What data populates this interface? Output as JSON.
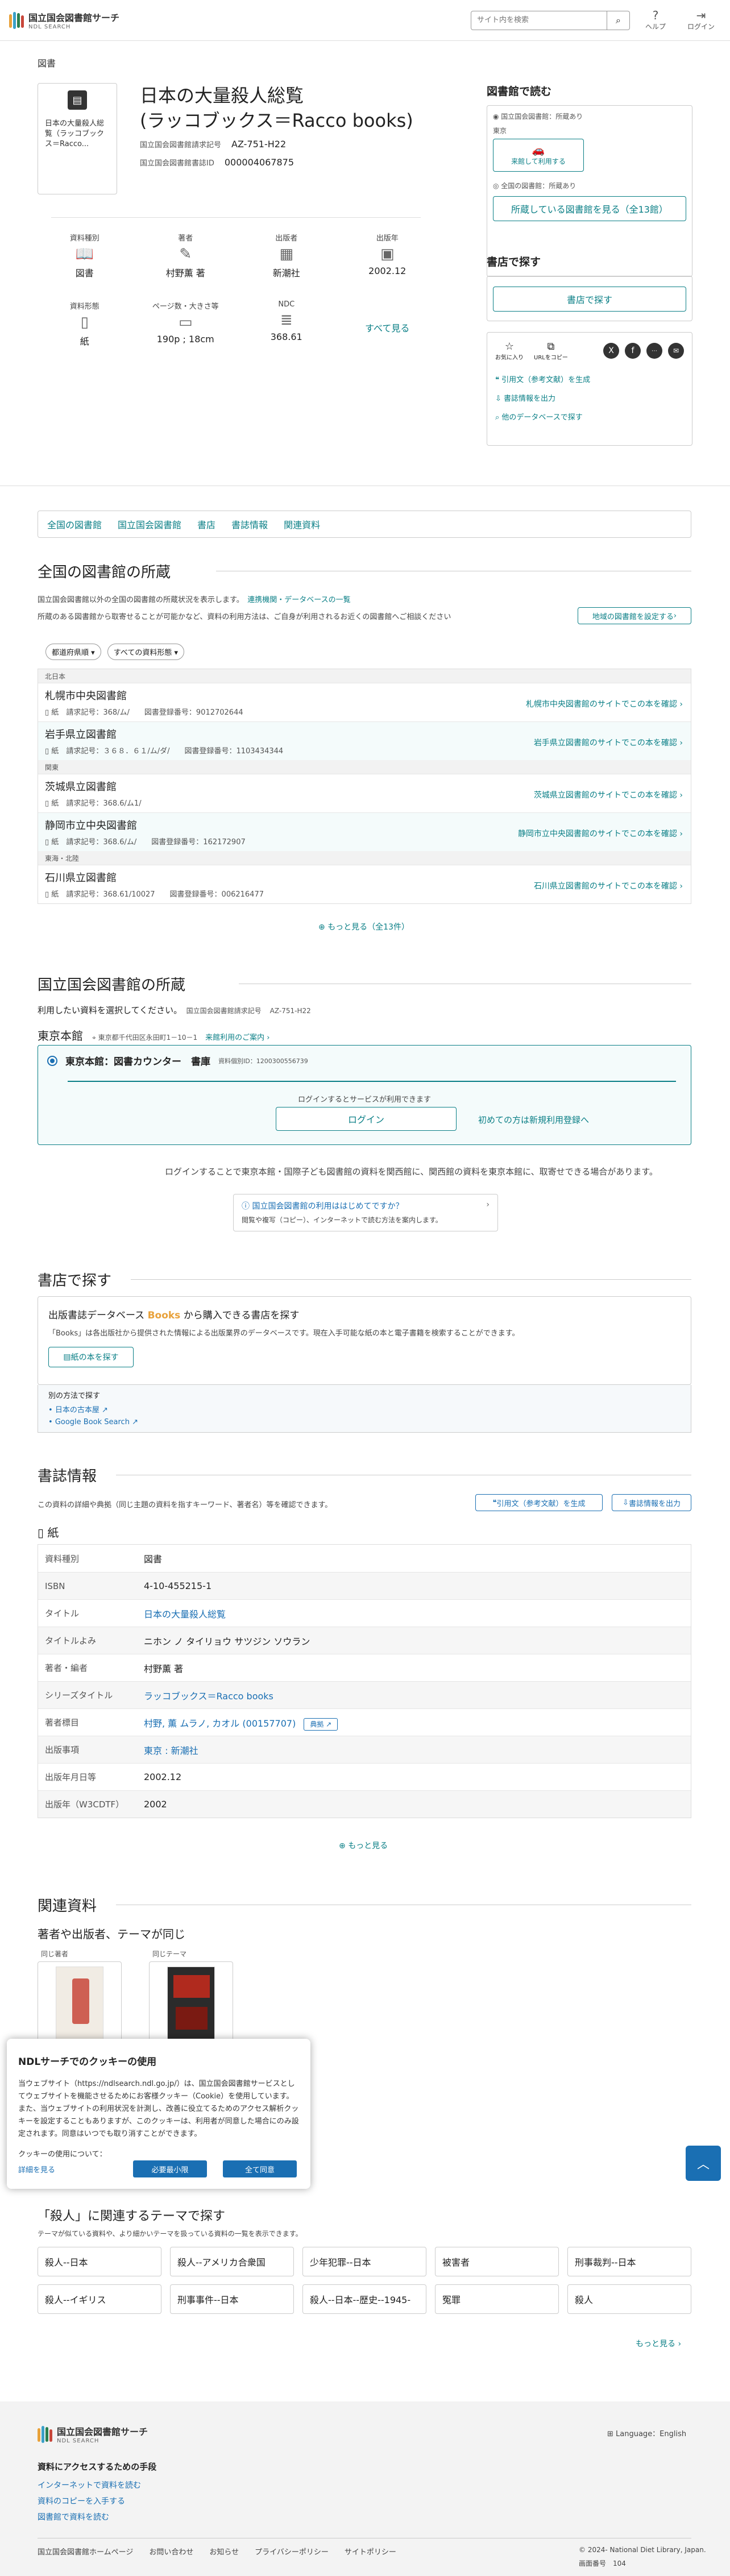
{
  "header": {
    "logo_line1": "国立国会図書館サーチ",
    "logo_line2": "NDL SEARCH",
    "search_placeholder": "サイト内を検索",
    "help": "ヘルプ",
    "login": "ログイン"
  },
  "breadcrumb": "図書",
  "record": {
    "thumb_title": "日本の大量殺人総覧（ラッコブックス＝Racco...",
    "title_line1": "日本の大量殺人総覧",
    "title_line2": "(ラッコブックス＝Racco books)",
    "callno_label": "国立国会図書館請求記号",
    "callno": "AZ-751-H22",
    "bibid_label": "国立国会図書館書誌ID",
    "bibid": "000004067875"
  },
  "attributes": [
    {
      "key": "資料種別",
      "value": "図書",
      "icon": "book-icon"
    },
    {
      "key": "著者",
      "value": "村野薫 著",
      "icon": "pen-icon"
    },
    {
      "key": "出版者",
      "value": "新潮社",
      "icon": "building-icon"
    },
    {
      "key": "出版年",
      "value": "2002.12",
      "icon": "calendar-icon"
    },
    {
      "key": "資料形態",
      "value": "紙",
      "icon": "paper-icon"
    },
    {
      "key": "ページ数・大きさ等",
      "value": "190p ; 18cm",
      "icon": "ruler-icon"
    },
    {
      "key": "NDC",
      "value": "368.61",
      "icon": "layers-icon"
    }
  ],
  "see_all": "すべて見る",
  "side": {
    "read_title": "図書館で読む",
    "ndl_owned": "国立国会図書館：所蔵あり",
    "tokyo": "東京",
    "use_at_library": "来館して利用する",
    "national_owned": "全国の図書館：所蔵あり",
    "show_libraries": "所蔵している図書館を見る（全13館）",
    "shop_title": "書店で探す",
    "find_in_shop": "書店で探す",
    "favorite": "お気に入り",
    "url_copy": "URLをコピー",
    "cite": "引用文（参考文献）を生成",
    "output": "書誌情報を出力",
    "other_db": "他のデータベースで探す"
  },
  "tabs": [
    "全国の図書館",
    "国立国会図書館",
    "書店",
    "書誌情報",
    "関連資料"
  ],
  "national": {
    "title": "全国の図書館の所蔵",
    "desc": "国立国会図書館以外の全国の図書館の所蔵状況を表示します。",
    "link": "連携機関・データベースの一覧",
    "note": "所蔵のある図書館から取寄せることが可能かなど、資料の利用方法は、ご自身が利用されるお近くの図書館へご相談ください",
    "set_region": "地域の図書館を設定する",
    "filter1": "都道府県順",
    "filter2": "すべての資料形態",
    "regions": [
      {
        "name": "北日本",
        "rows": [
          {
            "lib": "札幌市中央図書館",
            "form": "紙",
            "detail": "請求記号：368/ム/　　図書登録番号：9012702644",
            "link": "札幌市中央図書館のサイトでこの本を確認"
          },
          {
            "lib": "岩手県立図書館",
            "form": "紙",
            "detail": "請求記号：３６８．６１/ム/ダ/　　図書登録番号：1103434344",
            "link": "岩手県立図書館のサイトでこの本を確認"
          }
        ]
      },
      {
        "name": "関東",
        "rows": [
          {
            "lib": "茨城県立図書館",
            "form": "紙",
            "detail": "請求記号：368.6/ム1/",
            "link": "茨城県立図書館のサイトでこの本を確認"
          },
          {
            "lib": "静岡市立中央図書館",
            "form": "紙",
            "detail": "請求記号：368.6/ム/　　図書登録番号：162172907",
            "link": "静岡市立中央図書館のサイトでこの本を確認"
          }
        ]
      },
      {
        "name": "東海・北陸",
        "rows": [
          {
            "lib": "石川県立図書館",
            "form": "紙",
            "detail": "請求記号：368.61/10027　　図書登録番号：006216477",
            "link": "石川県立図書館のサイトでこの本を確認"
          }
        ]
      }
    ],
    "more": "もっと見る（全13件）"
  },
  "ndl": {
    "title": "国立国会図書館の所蔵",
    "desc": "利用したい資料を選択してください。",
    "callno_label": "国立国会図書館請求記号",
    "callno": "AZ-751-H22",
    "branch": "東京本館",
    "address": "東京都千代田区永田町1－10－1",
    "hours": "来館利用のご案内",
    "counter": "東京本館：図書カウンター　書庫",
    "material_id": "資料個別ID：1200300556739",
    "login_note": "ログインするとサービスが利用できます",
    "login_btn": "ログイン",
    "register": "初めての方は新規利用登録へ",
    "notice": "ログインすることで東京本館・国際子ども図書館の資料を関西館に、関西館の資料を東京本館に、取寄せできる場合があります。",
    "guide_title": "国立国会図書館の利用ははじめてですか？",
    "guide_desc": "閲覧や複写（コピー）、インターネットで読む方法を案内します。"
  },
  "shop": {
    "title": "書店で探す",
    "heading_pre": "出版書誌データベース",
    "booke": "Books",
    "heading_post": "から購入できる書店を探す",
    "desc": "「Books」は各出版社から提供された情報による出版業界のデータベースです。現在入手可能な紙の本と電子書籍を検索することができます。",
    "btn": "紙の本を探す",
    "other": "別の方法で探す",
    "amazon": "日本の古本屋",
    "google": "Google Book Search"
  },
  "bib": {
    "title": "書誌情報",
    "desc": "この資料の詳細や典拠（同じ主題の資料を指すキーワード、著者名）等を確認できます。",
    "cite": "引用文（参考文献）を生成",
    "output": "書誌情報を出力",
    "form": "紙",
    "rows": [
      {
        "k": "資料種別",
        "v": "図書"
      },
      {
        "k": "ISBN",
        "v": "4-10-455215-1"
      },
      {
        "k": "タイトル",
        "v": "日本の大量殺人総覧"
      },
      {
        "k": "タイトルよみ",
        "v": "ニホン ノ タイリョウ サツジン ソウラン"
      },
      {
        "k": "著者・編者",
        "v": "村野薫 著"
      },
      {
        "k": "シリーズタイトル",
        "v": "ラッコブックス＝Racco books"
      },
      {
        "k": "著者標目",
        "v": "村野, 薫 ムラノ, カオル (00157707)"
      },
      {
        "k": "出版事項",
        "v": "東京 : 新潮社"
      },
      {
        "k": "出版年月日等",
        "v": "2002.12"
      },
      {
        "k": "出版年（W3CDTF）",
        "v": "2002"
      }
    ],
    "authority": "典拠",
    "more": "もっと見る"
  },
  "related": {
    "title": "関連資料",
    "sub": "著者や出版者、テーマが同じ",
    "same_author": "同じ著者",
    "same_theme": "同じテーマ"
  },
  "cookie": {
    "title": "NDLサーチでのクッキーの使用",
    "text": "当ウェブサイト（https://ndlsearch.ndl.go.jp/）は、国立国会図書館サービスとしてウェブサイトを機能させるためにお客様クッキー（Cookie）を使用しています。また、当ウェブサイトの利用状況を計測し、改善に役立てるためのアクセス解析クッキーを設定することもありますが、このクッキーは、利用者が同意した場合にのみ設定されます。同意はいつでも取り消すことができます。",
    "usage": "クッキーの使用について：",
    "details": "詳細を見る",
    "necessary": "必要最小限",
    "accept_all": "全て同意"
  },
  "keywords": {
    "title": "「殺人」に関連するテーマで探す",
    "desc": "テーマが似ている資料や、より細かいテーマを扱っている資料の一覧を表示できます。",
    "items": [
      "殺人--日本",
      "殺人--アメリカ合衆国",
      "少年犯罪--日本",
      "被害者",
      "刑事裁判--日本",
      "殺人--イギリス",
      "刑事事件--日本",
      "殺人--日本--歴史--1945-",
      "冤罪",
      "殺人"
    ],
    "more": "もっと見る"
  },
  "footer": {
    "logo1": "国立国会図書館サーチ",
    "logo2": "NDL SEARCH",
    "language": "Language：English",
    "access_title": "資料にアクセスするための手段",
    "links": [
      "インターネットで資料を読む",
      "資料のコピーを入手する",
      "図書館で資料を読む"
    ],
    "bottom": [
      "国立国会図書館ホームページ",
      "お問い合わせ",
      "お知らせ",
      "プライバシーポリシー",
      "サイトポリシー"
    ],
    "copyright": "© 2024- National Diet Library, Japan.",
    "screen_no_label": "画面番号",
    "screen_no": "104"
  },
  "colors": {
    "accent": "#0a7f86",
    "link": "#1a6fb3"
  }
}
